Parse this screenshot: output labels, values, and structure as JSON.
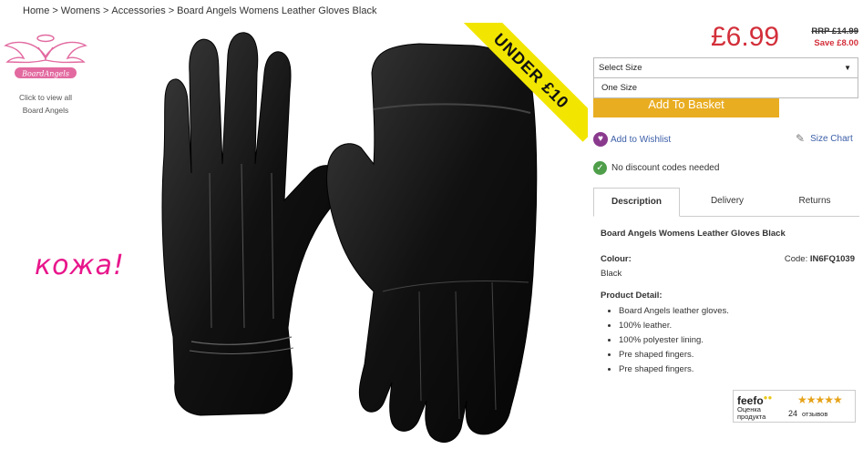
{
  "breadcrumb": {
    "items": [
      "Home",
      "Womens",
      "Accessories",
      "Board Angels Womens Leather Gloves Black"
    ],
    "separator": ">"
  },
  "brand": {
    "caption_line1": "Click to view all",
    "caption_line2": "Board Angels",
    "logo_text": "BoardAngels"
  },
  "annotation": {
    "text": "кожа!"
  },
  "promo": {
    "ribbon": "UNDER £10"
  },
  "pricing": {
    "price": "£6.99",
    "rrp": "RRP £14.99",
    "save": "Save £8.00"
  },
  "size": {
    "placeholder": "Select Size",
    "option": "One Size"
  },
  "actions": {
    "add_to_basket": "Add To Basket",
    "wishlist": "Add to Wishlist",
    "size_chart": "Size Chart",
    "discount_note": "No discount codes needed"
  },
  "tabs": [
    "Description",
    "Delivery",
    "Returns"
  ],
  "description": {
    "title": "Board Angels Womens Leather Gloves Black",
    "colour_label": "Colour:",
    "colour_value": "Black",
    "code_label": "Code:",
    "code_value": "IN6FQ1039",
    "detail_label": "Product Detail:",
    "details": [
      "Board Angels leather gloves.",
      "100% leather.",
      "100% polyester lining.",
      "Pre shaped fingers.",
      "Pre shaped fingers."
    ]
  },
  "feefo": {
    "logo": "feefo",
    "sub_line1": "Оценка",
    "sub_line2": "продукта",
    "stars": "★★★★★",
    "count": "24",
    "count_label": "отзывов"
  },
  "colors": {
    "price_red": "#d32f3a",
    "basket_orange": "#e9ad22",
    "ribbon_yellow": "#f2e600",
    "link_blue": "#3b5ea8",
    "annotation_pink": "#e8168b"
  }
}
